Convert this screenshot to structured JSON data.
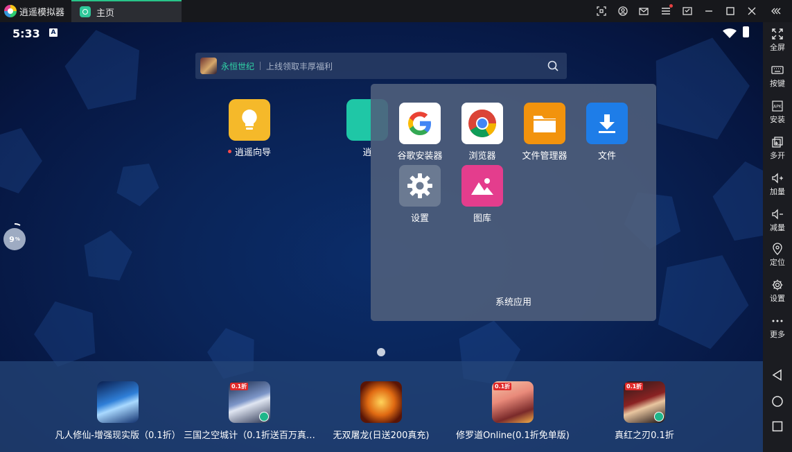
{
  "titlebar": {
    "app_name": "逍遥模拟器",
    "active_tab": "主页",
    "icons": [
      "screenshot-icon",
      "user-icon",
      "mail-icon",
      "menu-icon",
      "sync-icon",
      "minimize-icon",
      "maximize-icon",
      "close-icon",
      "collapse-icon"
    ]
  },
  "status": {
    "time": "5:33",
    "a_indicator": "A"
  },
  "search": {
    "game": "永恒世纪",
    "hint": "上线领取丰厚福利"
  },
  "desktop": {
    "apps": [
      {
        "label": "逍遥向导",
        "color": "#f5b92a"
      },
      {
        "label": "逍",
        "color": "#1fc7a6"
      }
    ]
  },
  "folder": {
    "name": "系统应用",
    "apps": [
      {
        "label": "谷歌安装器",
        "icon": "google-icon"
      },
      {
        "label": "浏览器",
        "icon": "chrome-icon"
      },
      {
        "label": "文件管理器",
        "icon": "folder-icon"
      },
      {
        "label": "文件",
        "icon": "download-icon"
      },
      {
        "label": "设置",
        "icon": "settings-gear-icon"
      },
      {
        "label": "图库",
        "icon": "gallery-icon"
      }
    ]
  },
  "progress_badge": {
    "value": "9",
    "unit": "%"
  },
  "dock": {
    "apps": [
      {
        "label": "凡人修仙-增强现实版（0.1折）"
      },
      {
        "label": "三国之空城计（0.1折送百万真…",
        "badge": "0.1折"
      },
      {
        "label": "无双屠龙(日送200真充)"
      },
      {
        "label": "修罗道Online(0.1折免单版)",
        "badge": "0.1折"
      },
      {
        "label": "真红之刃0.1折",
        "badge": "0.1折"
      }
    ]
  },
  "sidebar": {
    "items": [
      {
        "label": "全屏",
        "icon": "fullscreen-icon"
      },
      {
        "label": "按键",
        "icon": "keyboard-icon"
      },
      {
        "label": "安装",
        "icon": "apk-icon"
      },
      {
        "label": "多开",
        "icon": "multi-instance-icon"
      },
      {
        "label": "加量",
        "icon": "volume-up-icon"
      },
      {
        "label": "减量",
        "icon": "volume-down-icon"
      },
      {
        "label": "定位",
        "icon": "location-icon"
      },
      {
        "label": "设置",
        "icon": "gear-icon"
      },
      {
        "label": "更多",
        "icon": "more-icon"
      }
    ],
    "nav": [
      "back-icon",
      "home-icon",
      "recents-icon"
    ]
  },
  "colors": {
    "accent": "#28c48a",
    "screen_bg": "#0a2458",
    "sidebar_bg": "#1b1c21"
  }
}
